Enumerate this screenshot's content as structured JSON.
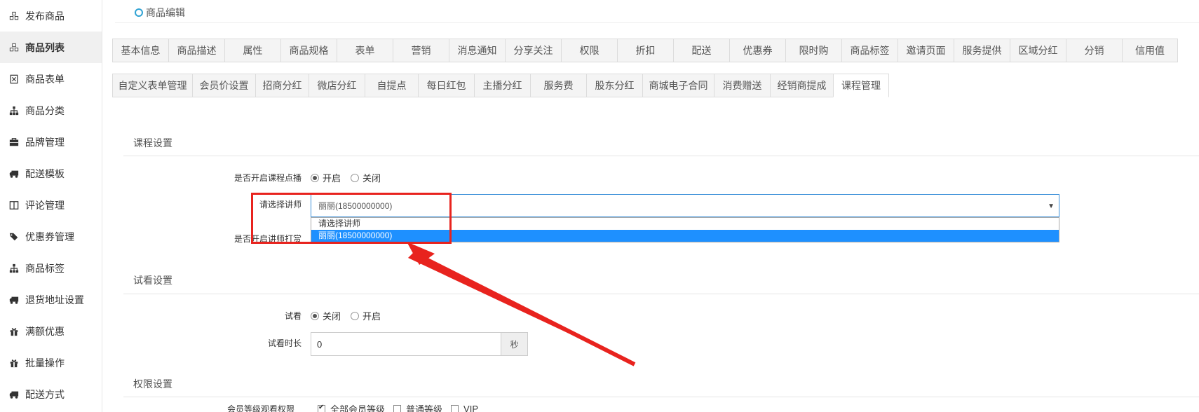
{
  "sidebar": {
    "items": [
      {
        "label": "发布商品",
        "icon": "cubes-icon"
      },
      {
        "label": "商品列表",
        "icon": "cubes-icon",
        "active": true
      },
      {
        "label": "商品表单",
        "icon": "excel-file-icon"
      },
      {
        "label": "商品分类",
        "icon": "sitemap-icon"
      },
      {
        "label": "品牌管理",
        "icon": "briefcase-icon"
      },
      {
        "label": "配送模板",
        "icon": "truck-icon"
      },
      {
        "label": "评论管理",
        "icon": "columns-icon"
      },
      {
        "label": "优惠券管理",
        "icon": "tags-icon"
      },
      {
        "label": "商品标签",
        "icon": "sitemap-icon"
      },
      {
        "label": "退货地址设置",
        "icon": "truck-icon"
      },
      {
        "label": "满额优惠",
        "icon": "gift-icon"
      },
      {
        "label": "批量操作",
        "icon": "gift-icon"
      },
      {
        "label": "配送方式",
        "icon": "truck-icon"
      }
    ]
  },
  "breadcrumb": {
    "label": "商品编辑"
  },
  "tabs_row1": [
    "基本信息",
    "商品描述",
    "属性",
    "商品规格",
    "表单",
    "营销",
    "消息通知",
    "分享关注",
    "权限",
    "折扣",
    "配送",
    "优惠券",
    "限时购",
    "商品标签",
    "邀请页面",
    "服务提供",
    "区域分红",
    "分销",
    "信用值"
  ],
  "tabs_row2": [
    {
      "label": "自定义表单管理",
      "w": 114
    },
    {
      "label": "会员价设置",
      "w": 90
    },
    {
      "label": "招商分红",
      "w": 76
    },
    {
      "label": "微店分红",
      "w": 80
    },
    {
      "label": "自提点",
      "w": 76
    },
    {
      "label": "每日红包",
      "w": 80
    },
    {
      "label": "主播分红",
      "w": 80
    },
    {
      "label": "服务费",
      "w": 80
    },
    {
      "label": "股东分红",
      "w": 80
    },
    {
      "label": "商城电子合同",
      "w": 102
    },
    {
      "label": "消费赠送",
      "w": 80
    },
    {
      "label": "经销商提成",
      "w": 90
    },
    {
      "label": "课程管理",
      "w": 80,
      "active": true
    }
  ],
  "course": {
    "section_title": "课程设置",
    "vod_label": "是否开启课程点播",
    "vod_options": [
      "开启",
      "关闭"
    ],
    "vod_selected": "开启",
    "lecturer_label": "请选择讲师",
    "lecturer_value": "丽丽(18500000000)",
    "lecturer_options": [
      "请选择讲师",
      "丽丽(18500000000)"
    ],
    "lecturer_selected_index": 1,
    "reward_label": "是否开启讲师打赏"
  },
  "trial": {
    "section_title": "试看设置",
    "trial_label": "试看",
    "trial_options": [
      "关闭",
      "开启"
    ],
    "trial_selected": "关闭",
    "duration_label": "试看时长",
    "duration_value": "0",
    "duration_unit": "秒"
  },
  "permission": {
    "section_title": "权限设置",
    "level_label": "会员等级观看权限",
    "level_options": [
      {
        "label": "全部会员等级",
        "checked": true
      },
      {
        "label": "普通等级",
        "checked": false
      },
      {
        "label": "VIP",
        "checked": false
      }
    ]
  },
  "annotation": {
    "color": "#e8231e"
  },
  "colors": {
    "accent": "#1e90ff",
    "select_border": "#3b8fd9",
    "breadcrumb_dot": "#31a3d4"
  }
}
